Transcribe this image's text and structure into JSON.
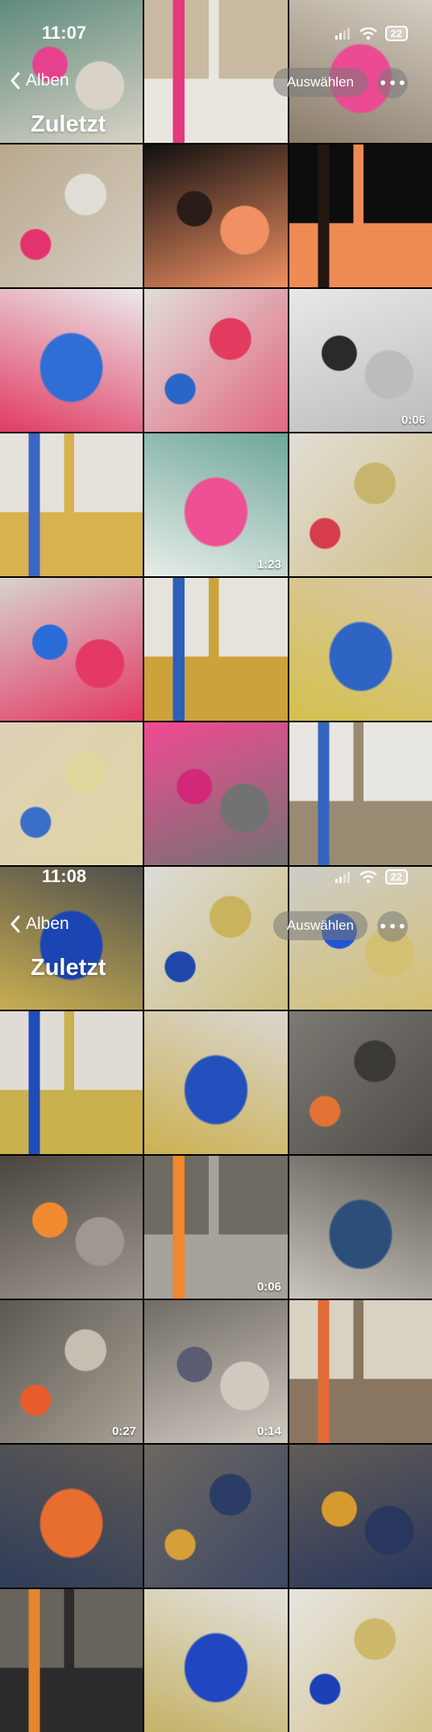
{
  "screens": [
    {
      "time": "11:07",
      "back_label": "Alben",
      "select_label": "Auswählen",
      "title": "Zuletzt",
      "battery": "22"
    },
    {
      "time": "11:08",
      "back_label": "Alben",
      "select_label": "Auswählen",
      "title": "Zuletzt",
      "battery": "22"
    }
  ],
  "thumbnails": [
    {
      "kind": "photo",
      "duration": "",
      "colors": [
        "#5f8b7c",
        "#e6418e",
        "#d8d3c6"
      ]
    },
    {
      "kind": "photo",
      "duration": "",
      "colors": [
        "#c8b9a0",
        "#e23a7d",
        "#e9e6df"
      ]
    },
    {
      "kind": "photo",
      "duration": "",
      "colors": [
        "#d4cdc1",
        "#eb4b93",
        "#8a7c6a"
      ]
    },
    {
      "kind": "photo",
      "duration": "",
      "colors": [
        "#b9a88d",
        "#e3326f",
        "#e0ddd6"
      ]
    },
    {
      "kind": "photo",
      "duration": "",
      "colors": [
        "#101010",
        "#2a1c16",
        "#f19062"
      ]
    },
    {
      "kind": "photo",
      "duration": "",
      "colors": [
        "#0d0d0d",
        "#221611",
        "#ee8b55"
      ]
    },
    {
      "kind": "photo",
      "duration": "",
      "colors": [
        "#eaeaea",
        "#2f6ed5",
        "#e23b63"
      ]
    },
    {
      "kind": "photo",
      "duration": "",
      "colors": [
        "#dfddd6",
        "#2a66c8",
        "#e33a60"
      ]
    },
    {
      "kind": "video",
      "duration": "0:06",
      "colors": [
        "#e8e8e8",
        "#2a2a2a",
        "#bcbcbc"
      ]
    },
    {
      "kind": "photo",
      "duration": "",
      "colors": [
        "#e5e2dc",
        "#3b67c2",
        "#d8b24f"
      ]
    },
    {
      "kind": "video",
      "duration": "1:23",
      "colors": [
        "#6ea79a",
        "#ef4f93",
        "#e8ede9"
      ]
    },
    {
      "kind": "photo",
      "duration": "",
      "colors": [
        "#e2ded6",
        "#d63c4c",
        "#c8b56d"
      ]
    },
    {
      "kind": "photo",
      "duration": "",
      "colors": [
        "#d6d3cc",
        "#2b6dd8",
        "#e43966"
      ]
    },
    {
      "kind": "photo",
      "duration": "",
      "colors": [
        "#e6e3dc",
        "#2c5fba",
        "#cda23b"
      ]
    },
    {
      "kind": "photo",
      "duration": "",
      "colors": [
        "#d9c7a6",
        "#2e64c4",
        "#d3c04d"
      ]
    },
    {
      "kind": "photo",
      "duration": "",
      "colors": [
        "#ddd0b5",
        "#3a6fc9",
        "#e0d79e"
      ]
    },
    {
      "kind": "photo",
      "duration": "",
      "colors": [
        "#f24a92",
        "#d2287a",
        "#727272"
      ]
    },
    {
      "kind": "photo",
      "duration": "",
      "colors": [
        "#e7e6e2",
        "#3564c1",
        "#9a8a72"
      ]
    },
    {
      "kind": "photo",
      "duration": "",
      "colors": [
        "#4f4f4c",
        "#1b45b3",
        "#c8ae52"
      ]
    },
    {
      "kind": "photo",
      "duration": "",
      "colors": [
        "#dcdcd8",
        "#2048ac",
        "#c9b45d"
      ]
    },
    {
      "kind": "photo",
      "duration": "",
      "colors": [
        "#cdcdc8",
        "#2056d4",
        "#d4c072"
      ]
    },
    {
      "kind": "photo",
      "duration": "",
      "colors": [
        "#e0dcd5",
        "#1f4cb8",
        "#c8b14e"
      ]
    },
    {
      "kind": "photo",
      "duration": "",
      "colors": [
        "#d9d6d0",
        "#2450bd",
        "#ccb152"
      ]
    },
    {
      "kind": "photo",
      "duration": "",
      "colors": [
        "#7d7a74",
        "#e17434",
        "#3c3a37"
      ]
    },
    {
      "kind": "photo",
      "duration": "",
      "colors": [
        "#4b4540",
        "#ef8a2f",
        "#9e9890"
      ]
    },
    {
      "kind": "video",
      "duration": "0:06",
      "colors": [
        "#6f6a62",
        "#f0882d",
        "#a7a29a"
      ]
    },
    {
      "kind": "photo",
      "duration": "",
      "colors": [
        "#5e5a55",
        "#2c4e7b",
        "#c9c5bd"
      ]
    },
    {
      "kind": "video",
      "duration": "0:27",
      "colors": [
        "#5d5952",
        "#e85c2c",
        "#c6beb1"
      ]
    },
    {
      "kind": "video",
      "duration": "0:14",
      "colors": [
        "#716c64",
        "#5b5b73",
        "#cfc9c0"
      ]
    },
    {
      "kind": "photo",
      "duration": "",
      "colors": [
        "#d9d1c2",
        "#e26a36",
        "#8a7660"
      ]
    },
    {
      "kind": "photo",
      "duration": "",
      "colors": [
        "#5e5953",
        "#e86e2f",
        "#2f3d5a"
      ]
    },
    {
      "kind": "photo",
      "duration": "",
      "colors": [
        "#6c6760",
        "#d4a037",
        "#2b3c66"
      ]
    },
    {
      "kind": "photo",
      "duration": "",
      "colors": [
        "#615c55",
        "#d79a2f",
        "#29365d"
      ]
    },
    {
      "kind": "photo",
      "duration": "",
      "colors": [
        "#68635c",
        "#e5862f",
        "#2b2b2b"
      ]
    },
    {
      "kind": "photo",
      "duration": "",
      "colors": [
        "#e3e1dd",
        "#2046c1",
        "#c4b267"
      ]
    },
    {
      "kind": "photo",
      "duration": "",
      "colors": [
        "#e6e4e0",
        "#1c40b8",
        "#cdb86b"
      ]
    }
  ]
}
